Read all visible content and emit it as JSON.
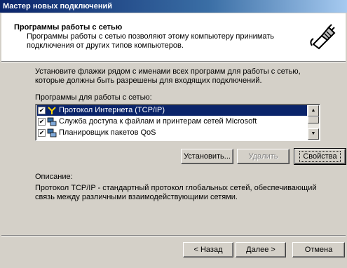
{
  "window": {
    "title": "Мастер новых подключений"
  },
  "header": {
    "title": "Программы работы с сетью",
    "description": "Программы работы с сетью позволяют этому компьютеру принимать подключения от других типов компьютеров.",
    "icon": "network-cable-plug-icon"
  },
  "main": {
    "intro": "Установите флажки рядом с именами всех программ для работы с сетью, которые должны быть разрешены для входящих подключений.",
    "list_label": "Программы для работы с сетью:",
    "list_items": [
      {
        "label": "Протокол Интернета (TCP/IP)",
        "checked": true,
        "selected": true,
        "icon": "protocol-icon"
      },
      {
        "label": "Служба доступа к файлам и принтерам сетей Microsoft",
        "checked": true,
        "selected": false,
        "icon": "network-service-icon"
      },
      {
        "label": "Планировщик пакетов QoS",
        "checked": true,
        "selected": false,
        "icon": "network-service-icon"
      }
    ],
    "buttons": {
      "install": "Установить...",
      "remove": "Удалить",
      "properties": "Свойства"
    },
    "description_label": "Описание:",
    "description_text": "Протокол TCP/IP - стандартный протокол глобальных сетей, обеспечивающий связь между различными взаимодействующими сетями."
  },
  "footer": {
    "back": "< Назад",
    "next": "Далее >",
    "cancel": "Отмена"
  },
  "colors": {
    "titlebar": "#0a246a",
    "selection": "#0a246a",
    "face": "#d4d0c8"
  }
}
